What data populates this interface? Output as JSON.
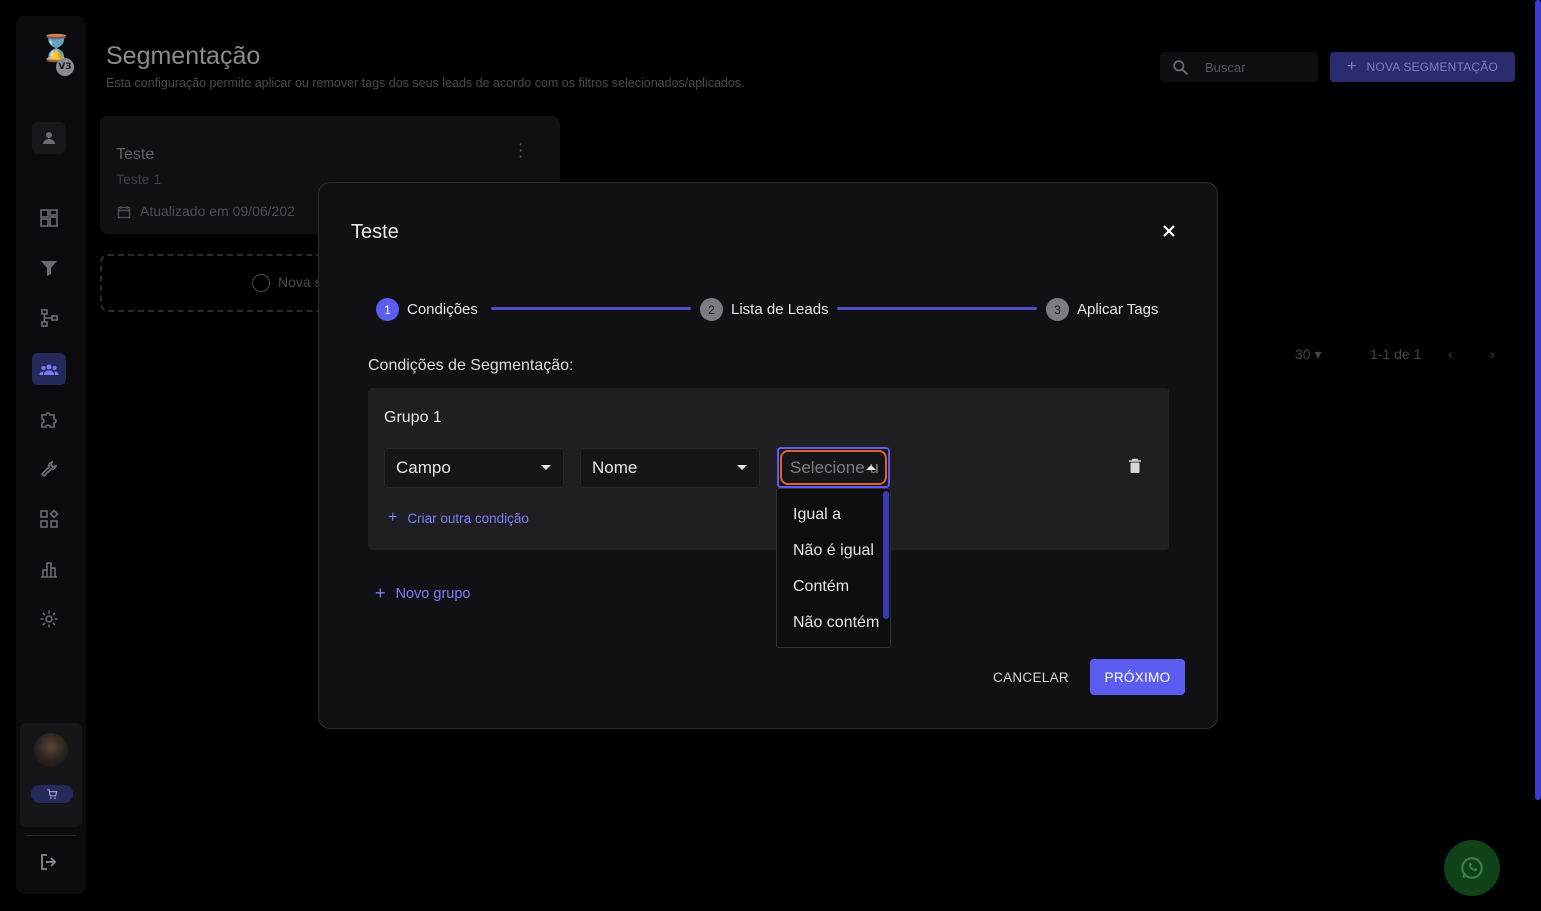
{
  "header": {
    "title": "Segmentação",
    "subtitle": "Esta configuração permite aplicar ou remover tags dos seus leads de acordo com os filtros selecionados/aplicados.",
    "search_placeholder": "Buscar",
    "new_button_label": "NOVA SEGMENTAÇÃO"
  },
  "logo": {
    "badge": "V3"
  },
  "sidebar": {
    "items": [
      {
        "icon": "dashboard-icon"
      },
      {
        "icon": "filter-icon"
      },
      {
        "icon": "flow-icon"
      },
      {
        "icon": "users-group-icon",
        "active": true
      },
      {
        "icon": "puzzle-icon"
      },
      {
        "icon": "wrench-icon"
      },
      {
        "icon": "apps-icon"
      },
      {
        "icon": "bar-chart-icon"
      },
      {
        "icon": "gear-icon"
      }
    ]
  },
  "background_card": {
    "title": "Teste",
    "subtitle": "Teste 1",
    "updated": "Atualizado em 09/06/202",
    "new_label": "Nova s"
  },
  "pagination": {
    "per_page": "30",
    "range": "1-1 de 1"
  },
  "modal": {
    "title": "Teste",
    "steps": [
      {
        "num": "1",
        "label": "Condições"
      },
      {
        "num": "2",
        "label": "Lista de Leads"
      },
      {
        "num": "3",
        "label": "Aplicar Tags"
      }
    ],
    "section_label": "Condições de Segmentação:",
    "group": {
      "title": "Grupo 1",
      "field_select": "Campo",
      "field_name": "Nome",
      "operator_placeholder": "Selecione u",
      "add_condition": "Criar outra condição"
    },
    "operator_options": [
      "Igual a",
      "Não é igual",
      "Contém",
      "Não contém"
    ],
    "add_group": "Novo grupo",
    "cancel_label": "CANCELAR",
    "next_label": "PRÓXIMO"
  },
  "colors": {
    "accent": "#5b5cf0",
    "focus_ring": "#e0602e",
    "background": "#000002"
  }
}
